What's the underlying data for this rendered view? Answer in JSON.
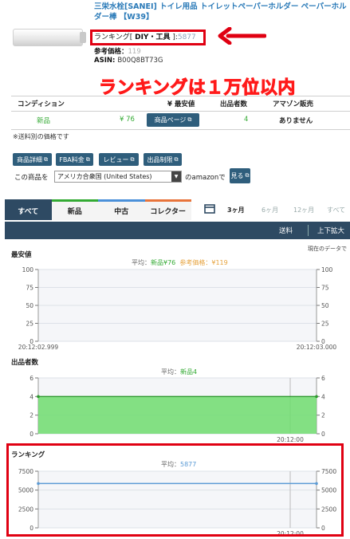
{
  "product": {
    "title": "三栄水栓[SANEI] トイレ用品 トイレットペーパーホルダー ペーパーホルダー棒 【W39】",
    "ranking_label": "ランキング[ ",
    "ranking_category": "DIY・工具",
    "ranking_sep": " ]:",
    "ranking_value": "5877",
    "ref_price_label": "参考価格：",
    "ref_price_value": "119",
    "asin_label": "ASIN: ",
    "asin_value": "B00Q8BT73G"
  },
  "annotation": {
    "banner": "ランキングは１万位以内"
  },
  "condition_table": {
    "headers": [
      "コンディション",
      "¥ 最安値",
      "出品者数",
      "アマゾン販売"
    ],
    "row": {
      "condition": "新品",
      "price": "¥ 76",
      "page_button": "商品ページ",
      "sellers": "4",
      "amazon": "ありません"
    }
  },
  "note": "※送料別の価格です",
  "buttons": [
    "商品詳細",
    "FBA料金",
    "レビュー",
    "出品制限"
  ],
  "country": {
    "prefix": "この商品を",
    "selected": "アメリカ合衆国 (United States)",
    "suffix": "のamazonで",
    "view_button": "見る"
  },
  "tabs": [
    "すべて",
    "新品",
    "中古",
    "コレクター"
  ],
  "ranges": [
    "3ヶ月",
    "6ヶ月",
    "12ヶ月",
    "すべて"
  ],
  "toolbar": {
    "shipping": "送料",
    "zoom": "上下拡大"
  },
  "current_data_note": "現在のデータで",
  "colors": {
    "accent": "#2e4a63",
    "new": "#33aa33",
    "ref": "#e6a23c",
    "rank": "#5b9bd5",
    "annotation": "#e00012"
  },
  "chart_data": [
    {
      "type": "line",
      "title": "最安値",
      "legend": [
        {
          "name": "平均：",
          "color": "#666"
        },
        {
          "name": "新品¥76",
          "color": "#33aa33"
        },
        {
          "name": "参考価格：¥119",
          "color": "#e6a23c"
        }
      ],
      "ylim": [
        0,
        100
      ],
      "yticks": [
        0,
        25,
        50,
        75,
        100
      ],
      "xticks": [
        "20:12:02.999",
        "20:12:03.000"
      ],
      "series": []
    },
    {
      "type": "area",
      "title": "出品者数",
      "legend": [
        {
          "name": "平均：",
          "color": "#666"
        },
        {
          "name": "新品4",
          "color": "#33aa33"
        }
      ],
      "ylim": [
        0,
        6
      ],
      "yticks": [
        0,
        2,
        4,
        6
      ],
      "xticks": [
        "20:12:00"
      ],
      "series": [
        {
          "name": "新品",
          "values": [
            4,
            4
          ]
        }
      ]
    },
    {
      "type": "line",
      "title": "ランキング",
      "legend": [
        {
          "name": "平均：",
          "color": "#666"
        },
        {
          "name": "5877",
          "color": "#5b9bd5"
        }
      ],
      "ylim": [
        0,
        7500
      ],
      "yticks": [
        0,
        2500,
        5000,
        7500
      ],
      "xticks": [
        "20:12:00"
      ],
      "series": [
        {
          "name": "ランキング",
          "values": [
            5877,
            5877
          ]
        }
      ]
    }
  ]
}
